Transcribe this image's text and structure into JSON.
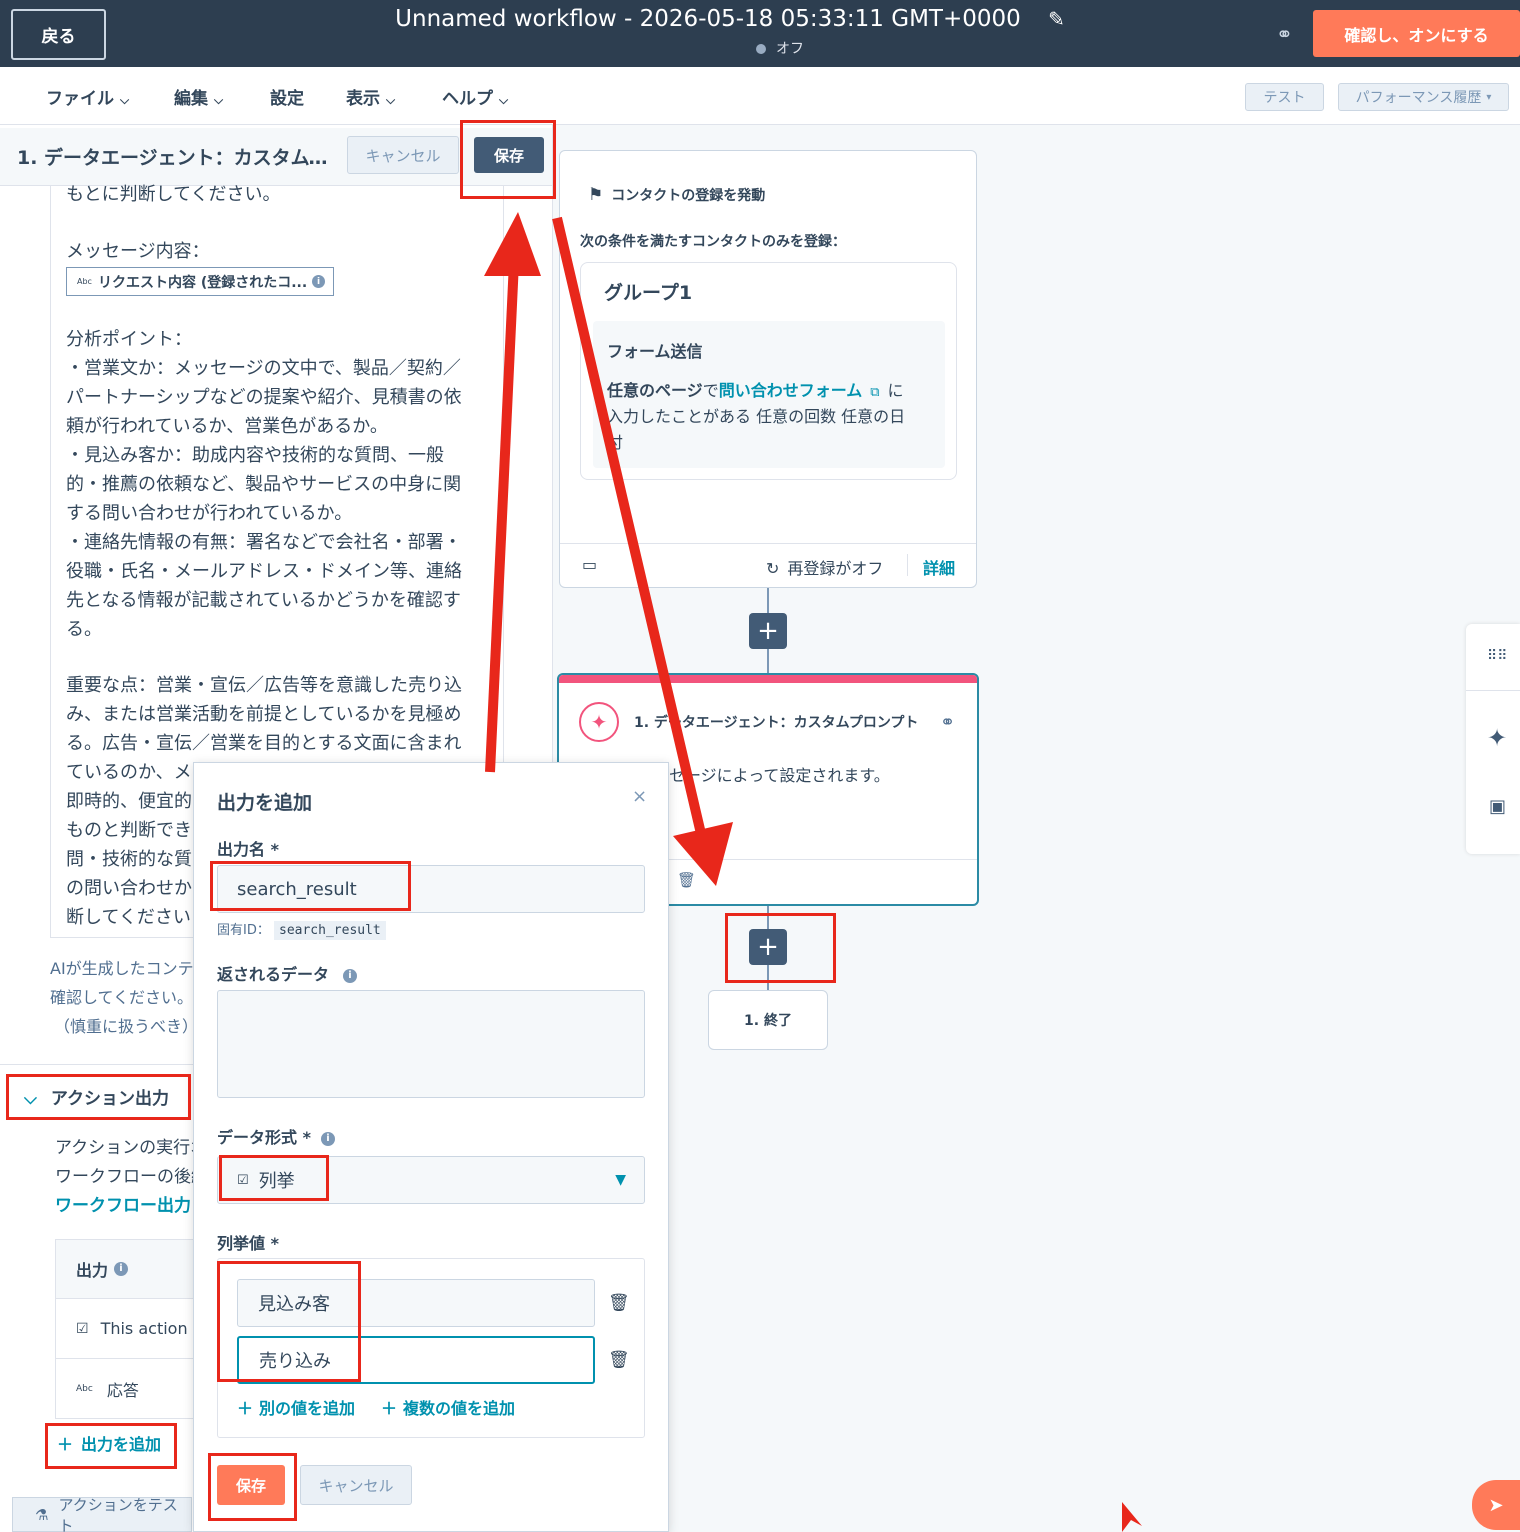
{
  "header": {
    "back_label": "戻る",
    "workflow_title": "Unnamed workflow - 2026-05-18 05:33:11 GMT+0000",
    "status": "オフ",
    "confirm_label": "確認し、オンにする"
  },
  "menu": {
    "items": [
      "ファイル",
      "編集",
      "設定",
      "表示",
      "ヘルプ"
    ],
    "test_label": "テスト",
    "performance_label": "パフォーマンス履歴"
  },
  "left_panel": {
    "title": "1. データエージェント：カスタムプ...",
    "cancel_label": "キャンセル",
    "save_label": "保存",
    "prompt_lines": [
      "もとに判断してください。",
      "",
      "メッセージ内容：",
      "",
      "",
      "分析ポイント：",
      "・営業文か：メッセージの文中で、製品／契約／",
      "パートナーシップなどの提案や紹介、見積書の依",
      "頼が行われているか、営業色があるか。",
      "・見込み客か：助成内容や技術的な質問、一般",
      "的・推薦の依頼など、製品やサービスの中身に関",
      "する問い合わせが行われているか。",
      "・連絡先情報の有無：署名などで会社名・部署・",
      "役職・氏名・メールアドレス・ドメイン等、連絡",
      "先となる情報が記載されているかどうかを確認す",
      "る。",
      "",
      "重要な点：営業・宣伝／広告等を意識した売り込",
      "み、または営業活動を前提としているかを見極め",
      "る。広告・宣伝／営業を目的とする文面に含まれ",
      "ているのか、メ",
      "即時的、便宜的",
      "ものと判断でき",
      "問・技術的な質",
      "の問い合わせか",
      "断してください"
    ],
    "token_label": "リクエスト内容 (登録されたコ...",
    "ai_note_lines": [
      "AIが生成したコンテ",
      "確認してください。",
      "（慎重に扱うべき）"
    ],
    "action_output_label": "アクション出力",
    "action_desc_lines": [
      "アクションの実行オ",
      "ワークフローの後続"
    ],
    "workflow_output_link": "ワークフロー出力",
    "output_table": {
      "header": "出力",
      "rows": [
        {
          "icon": "enum-icon",
          "label": "This action"
        },
        {
          "icon": "text-icon",
          "label": "応答"
        }
      ]
    },
    "add_output_label": "出力を追加",
    "test_action_label": "アクションをテスト"
  },
  "canvas": {
    "trigger": {
      "title": "コンタクトの登録を発動",
      "subtitle": "次の条件を満たすコンタクトのみを登録：",
      "group_title": "グループ1",
      "filter_title": "フォーム送信",
      "filter_prefix": "任意のページ",
      "filter_mid": "で",
      "filter_link": "問い合わせフォーム",
      "filter_suffix": "に",
      "filter_line2": "入力したことがある 任意の回数 任意の日",
      "filter_line3": "付",
      "reenroll": "再登録がオフ",
      "details": "詳細"
    },
    "action": {
      "title": "1. データエージェント：カスタムプロンプト",
      "body": "セージによって設定されます。"
    },
    "end_label": "1. 終了"
  },
  "modal": {
    "title": "出力を追加",
    "name_label": "出力名 *",
    "name_value": "search_result",
    "uid_label": "固有ID：",
    "uid_value": "search_result",
    "returned_data_label": "返されるデータ",
    "data_format_label": "データ形式 *",
    "data_format_value": "列挙",
    "enum_label": "列挙値 *",
    "enum_values": [
      "見込み客",
      "売り込み"
    ],
    "add_value_label": "別の値を追加",
    "add_multiple_label": "複数の値を追加",
    "save_label": "保存",
    "cancel_label": "キャンセル"
  },
  "colors": {
    "header_bg": "#2d3e50",
    "accent_orange": "#ff7a59",
    "link_teal": "#0091ae",
    "annotation_red": "#e8271b",
    "ai_pink": "#f2547d"
  }
}
